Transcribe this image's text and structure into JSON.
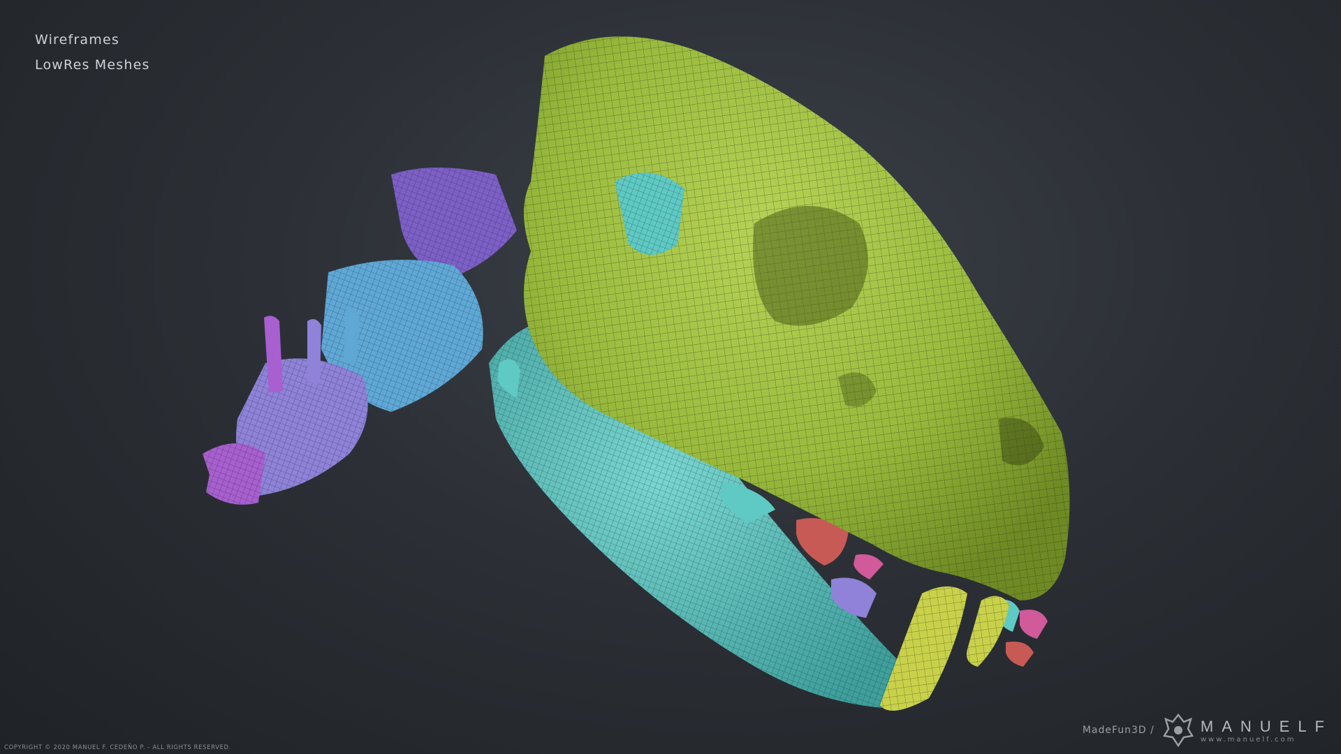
{
  "labels": {
    "line1": "Wireframes",
    "line2": "LowRes Meshes"
  },
  "copyright": "COPYRIGHT © 2020 MANUEL F. CEDEÑO P. - ALL RIGHTS RESERVED.",
  "brand": {
    "madefun": "MadeFun3D /",
    "name": "MANUELF",
    "site": "www.manuelf.com"
  },
  "colors": {
    "skull": "#9fc13e",
    "jaw": "#5fc9c3",
    "vertebra_blue": "#5fa8d6",
    "vertebra_purple": "#7d5fc6",
    "vertebra_violet": "#a85fcf",
    "fang": "#c9d14a",
    "tooth_red": "#c85a55",
    "tooth_pink": "#d05a9a",
    "tooth_lavender": "#8f82d8"
  }
}
